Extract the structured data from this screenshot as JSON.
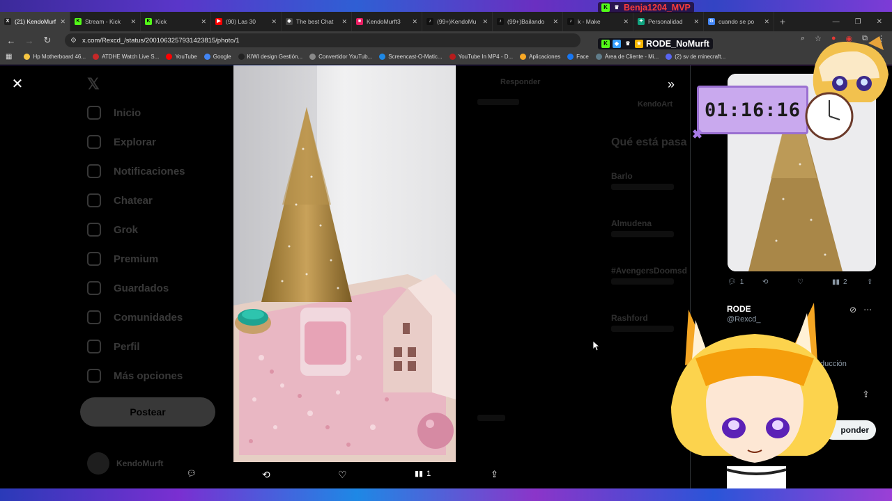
{
  "browser": {
    "tabs": [
      {
        "label": "(21) KendoMurf",
        "color": "#222",
        "glyph": "X"
      },
      {
        "label": "Stream - Kick",
        "color": "#53fc18",
        "glyph": "K"
      },
      {
        "label": "Kick",
        "color": "#53fc18",
        "glyph": "K"
      },
      {
        "label": "(90) Las 30",
        "color": "#ff0000",
        "glyph": "▶"
      },
      {
        "label": "The best Chat",
        "color": "#444",
        "glyph": "◆"
      },
      {
        "label": "KendoMurft3",
        "color": "#e91e63",
        "glyph": "■"
      },
      {
        "label": "(99+)KendoMu",
        "color": "#111",
        "glyph": "♪"
      },
      {
        "label": "(99+)Bailando",
        "color": "#111",
        "glyph": "♪"
      },
      {
        "label": "k - Make",
        "color": "#111",
        "glyph": "♪"
      },
      {
        "label": "Personalidad",
        "color": "#10a37f",
        "glyph": "✦"
      },
      {
        "label": "cuando se po",
        "color": "#4285f4",
        "glyph": "G"
      }
    ],
    "url": "x.com/Rexcd_/status/2001063257931423815/photo/1",
    "bookmarks": [
      {
        "label": "Hp Motherboard 46...",
        "color": "#f5c542"
      },
      {
        "label": "ATDHE Watch Live S...",
        "color": "#c62828"
      },
      {
        "label": "YouTube",
        "color": "#ff0000"
      },
      {
        "label": "Google",
        "color": "#4285f4"
      },
      {
        "label": "KIWI design Gestión...",
        "color": "#222"
      },
      {
        "label": "Convertidor YouTub...",
        "color": "#888"
      },
      {
        "label": "Screencast-O-Matic...",
        "color": "#1e88e5"
      },
      {
        "label": "YouTube In MP4 - D...",
        "color": "#b71c1c"
      },
      {
        "label": "Aplicaciones",
        "color": "#f9a825"
      },
      {
        "label": "Face",
        "color": "#1877f2"
      },
      {
        "label": "Área de Cliente - Mi...",
        "color": "#607d8b"
      },
      {
        "label": "(2) sv de minecraft...",
        "color": "#5865f2"
      }
    ]
  },
  "sidebar": {
    "items": [
      {
        "label": "Inicio"
      },
      {
        "label": "Explorar"
      },
      {
        "label": "Notificaciones"
      },
      {
        "label": "Chatear"
      },
      {
        "label": "Grok"
      },
      {
        "label": "Premium"
      },
      {
        "label": "Guardados"
      },
      {
        "label": "Comunidades"
      },
      {
        "label": "Perfil"
      },
      {
        "label": "Más opciones"
      }
    ],
    "post_label": "Postear",
    "profile_name": "KendoMurft"
  },
  "right_ghost": {
    "reply_label": "Responder",
    "happening_title": "Qué está pasa",
    "trends": [
      {
        "name": "Barlo"
      },
      {
        "name": "Almudena"
      },
      {
        "name": "#AvengersDoomsd"
      },
      {
        "name": "Rashford"
      }
    ],
    "kendo_label": "KendoArt"
  },
  "viewer": {
    "actions": {
      "replies": "",
      "reposts": "",
      "likes": "",
      "views": "1"
    }
  },
  "panel": {
    "actions": {
      "replies": "1",
      "reposts": "",
      "likes": "",
      "views": "2"
    },
    "user_name": "RODE",
    "user_handle": "@Rexcd_",
    "produccion_text": "ducción",
    "reply_label": "ponder"
  },
  "overlay": {
    "streamer_tag": "Benja1204_MVP",
    "viewer_tag": "RODE_NoMurft",
    "timer": "01:16:16",
    "accent": "#c9a9ee"
  }
}
